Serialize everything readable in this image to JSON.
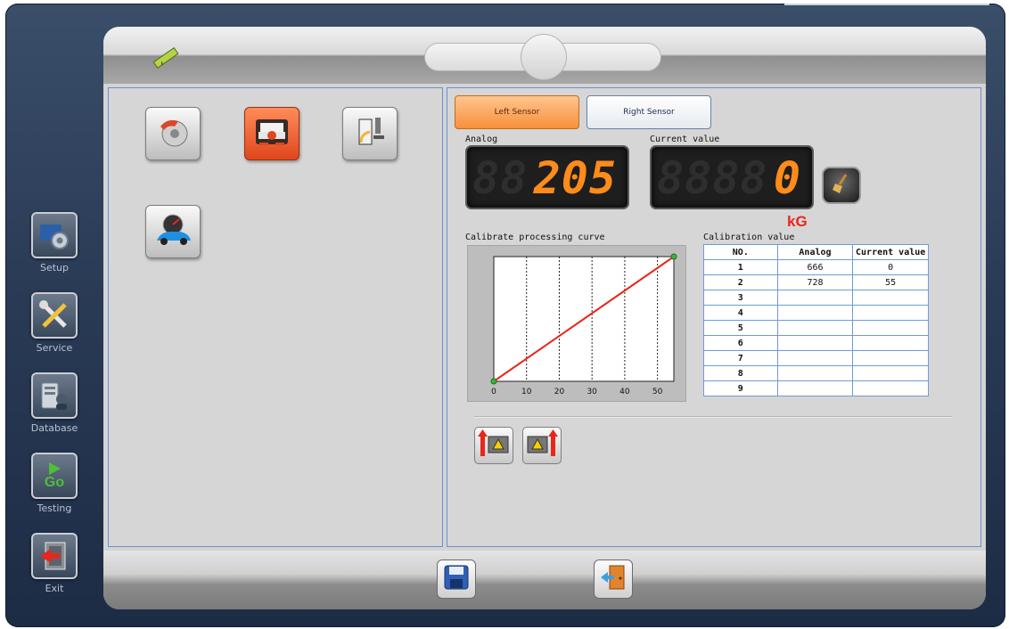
{
  "nav": {
    "items": [
      {
        "label": "Setup",
        "icon": "setup-gear-icon"
      },
      {
        "label": "Service",
        "icon": "tools-icon"
      },
      {
        "label": "Database",
        "icon": "database-server-icon"
      },
      {
        "label": "Testing",
        "icon": "go-icon",
        "icon_text": "Go"
      },
      {
        "label": "Exit",
        "icon": "exit-door-icon"
      }
    ]
  },
  "header": {
    "logo_icon": "ruler-icon"
  },
  "modes": [
    {
      "icon": "brake-disc-icon",
      "active": false
    },
    {
      "icon": "car-front-icon",
      "active": true
    },
    {
      "icon": "pedal-force-icon",
      "active": false
    },
    {
      "icon": "speedometer-car-icon",
      "active": false
    }
  ],
  "sensor": {
    "left_tab": "Left Sensor",
    "right_tab": "Right Sensor",
    "active_tab": "left",
    "analog_label": "Analog",
    "current_label": "Current value",
    "analog_value": "205",
    "current_value": "0",
    "unit": "kG",
    "clear_icon": "broom-icon"
  },
  "chart_title": "Calibrate processing curve",
  "chart_data": {
    "type": "line",
    "title": "",
    "xlabel": "",
    "ylabel": "",
    "x_ticks": [
      0,
      10,
      20,
      30,
      40,
      50
    ],
    "xlim": [
      0,
      55
    ],
    "grid": "vertical dashed",
    "series": [
      {
        "color": "#e8261d",
        "points": [
          [
            0,
            0
          ],
          [
            55,
            100
          ]
        ]
      }
    ],
    "markers": {
      "color": "#3cb43c"
    }
  },
  "table": {
    "title": "Calibration value",
    "headers": [
      "NO.",
      "Analog",
      "Current value"
    ],
    "rows": [
      [
        "1",
        "666",
        "0"
      ],
      [
        "2",
        "728",
        "55"
      ],
      [
        "3",
        "",
        ""
      ],
      [
        "4",
        "",
        ""
      ],
      [
        "5",
        "",
        ""
      ],
      [
        "6",
        "",
        ""
      ],
      [
        "7",
        "",
        ""
      ],
      [
        "8",
        "",
        ""
      ],
      [
        "9",
        "",
        ""
      ]
    ]
  },
  "actions": {
    "calib_left_icon": "calibrate-up-left-icon",
    "calib_right_icon": "calibrate-up-right-icon",
    "save_icon": "save-floppy-icon",
    "exit_icon": "exit-door-icon"
  },
  "colors": {
    "accent_orange": "#f7903c",
    "segment_digit": "#ff8b1a",
    "unit_red": "#e8261d",
    "grid_border": "#6f9bd6"
  }
}
